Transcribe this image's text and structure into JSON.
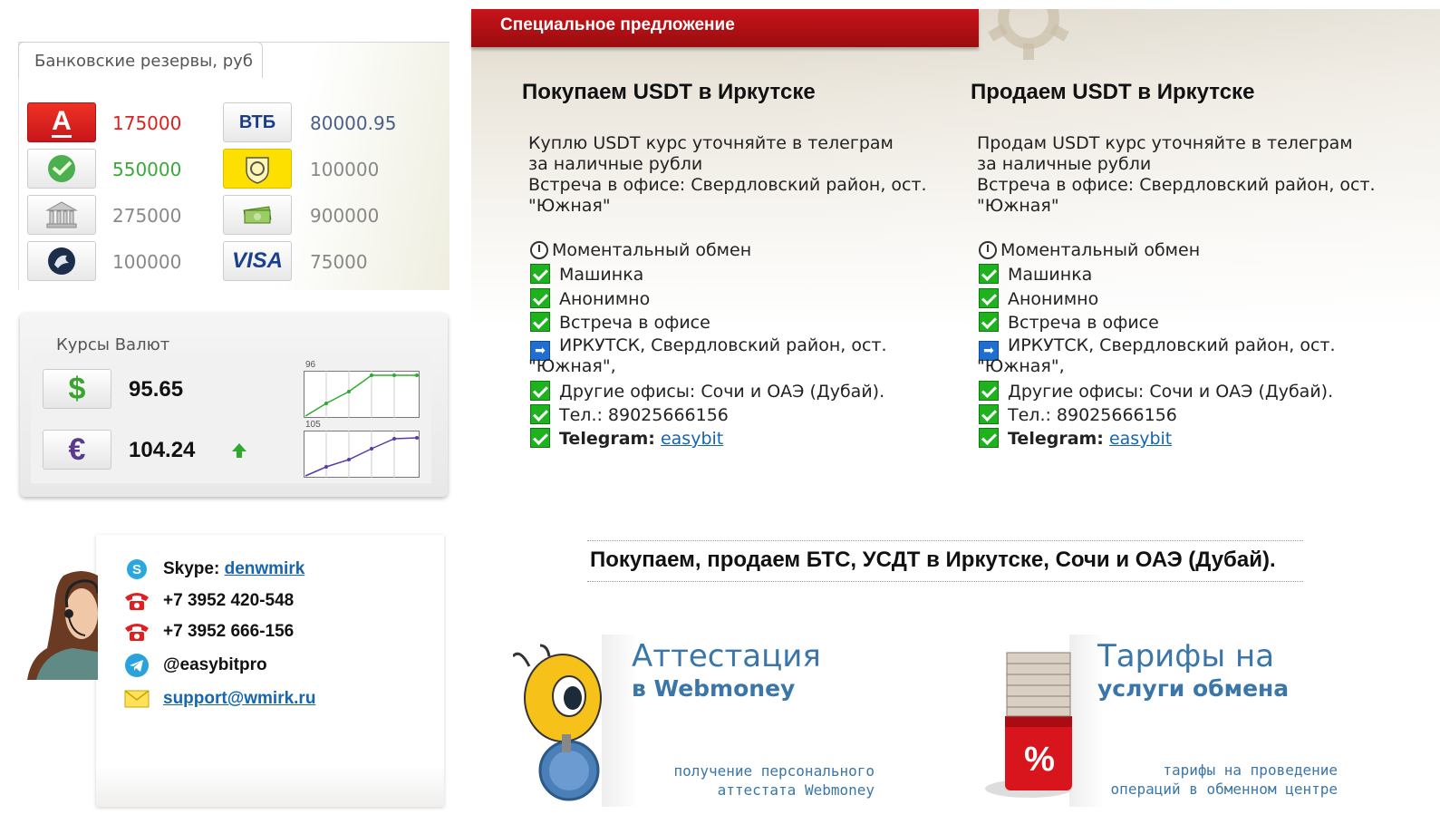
{
  "reserves": {
    "title": "Банковские резервы, руб",
    "banks": [
      {
        "icon": "alfa-bank-icon",
        "label": "А",
        "value": "175000",
        "color": "#e02020"
      },
      {
        "icon": "vtb-icon",
        "label": "ВТБ",
        "value": "80000.95",
        "color": "#4a5f8c"
      },
      {
        "icon": "sberbank-icon",
        "value": "550000",
        "color": "#3ca83c"
      },
      {
        "icon": "tinkoff-icon",
        "value": "100000",
        "color": "#888888"
      },
      {
        "icon": "bank-building-icon",
        "value": "275000",
        "color": "#888888"
      },
      {
        "icon": "cash-icon",
        "value": "900000",
        "color": "#888888"
      },
      {
        "icon": "russian-standard-icon",
        "value": "100000",
        "color": "#888888"
      },
      {
        "icon": "visa-icon",
        "label": "VISA",
        "value": "75000",
        "color": "#888888"
      }
    ]
  },
  "rates": {
    "title": "Курсы Валют",
    "items": [
      {
        "symbol": "$",
        "value": "95.65",
        "chart_label": "96"
      },
      {
        "symbol": "€",
        "value": "104.24",
        "chart_label": "105",
        "trend": "up"
      }
    ]
  },
  "contacts": {
    "skype_label": "Skype:",
    "skype_link": "denwmirk",
    "phone1": "+7 3952 420-548",
    "phone2": "+7 3952 666-156",
    "telegram": "@easybitpro",
    "email": "support@wmirk.ru"
  },
  "offer": {
    "title": "Специальное предложение",
    "columns": [
      {
        "heading": "Покупаем USDT в Иркутске",
        "body": [
          "Куплю USDT курс уточняйте в телеграм",
          "за наличные рубли",
          "Встреча в офисе: Свердловский район, ост.",
          "\"Южная\""
        ],
        "instant": "Моментальный обмен",
        "f1": "Машинка",
        "f2": "Анонимно",
        "f3": "Встреча в офисе",
        "address1": "ИРКУТСК, Свердловский район, ост.",
        "address2": "\"Южная\",",
        "f4": "Другие офисы: Сочи и ОАЭ (Дубай).",
        "phone": "Тел.: 89025666156",
        "tg_label": "Telegram:",
        "tg_link": "easybit"
      },
      {
        "heading": "Продаем USDT в Иркутске",
        "body": [
          "Продам USDT курс уточняйте в телеграм",
          "за наличные рубли",
          "Встреча в офисе: Свердловский район, ост.",
          "\"Южная\""
        ],
        "instant": "Моментальный обмен",
        "f1": "Машинка",
        "f2": "Анонимно",
        "f3": "Встреча в офисе",
        "address1": "ИРКУТСК, Свердловский район, ост.",
        "address2": "\"Южная\",",
        "f4": "Другие офисы: Сочи и ОАЭ (Дубай).",
        "phone": "Тел.: 89025666156",
        "tg_label": "Telegram:",
        "tg_link": "easybit"
      }
    ]
  },
  "slogan": "Покупаем, продаем БТС, УСДТ в Иркутске, Сочи и ОАЭ (Дубай).",
  "promos": [
    {
      "heading": "Аттестация",
      "sub": "в Webmoney",
      "caption1": "получение персонального",
      "caption2": "аттестата Webmoney"
    },
    {
      "heading": "Тарифы на",
      "sub": "услуги обмена",
      "caption1": "тарифы на проведение",
      "caption2": "операций в обменном центре"
    }
  ]
}
